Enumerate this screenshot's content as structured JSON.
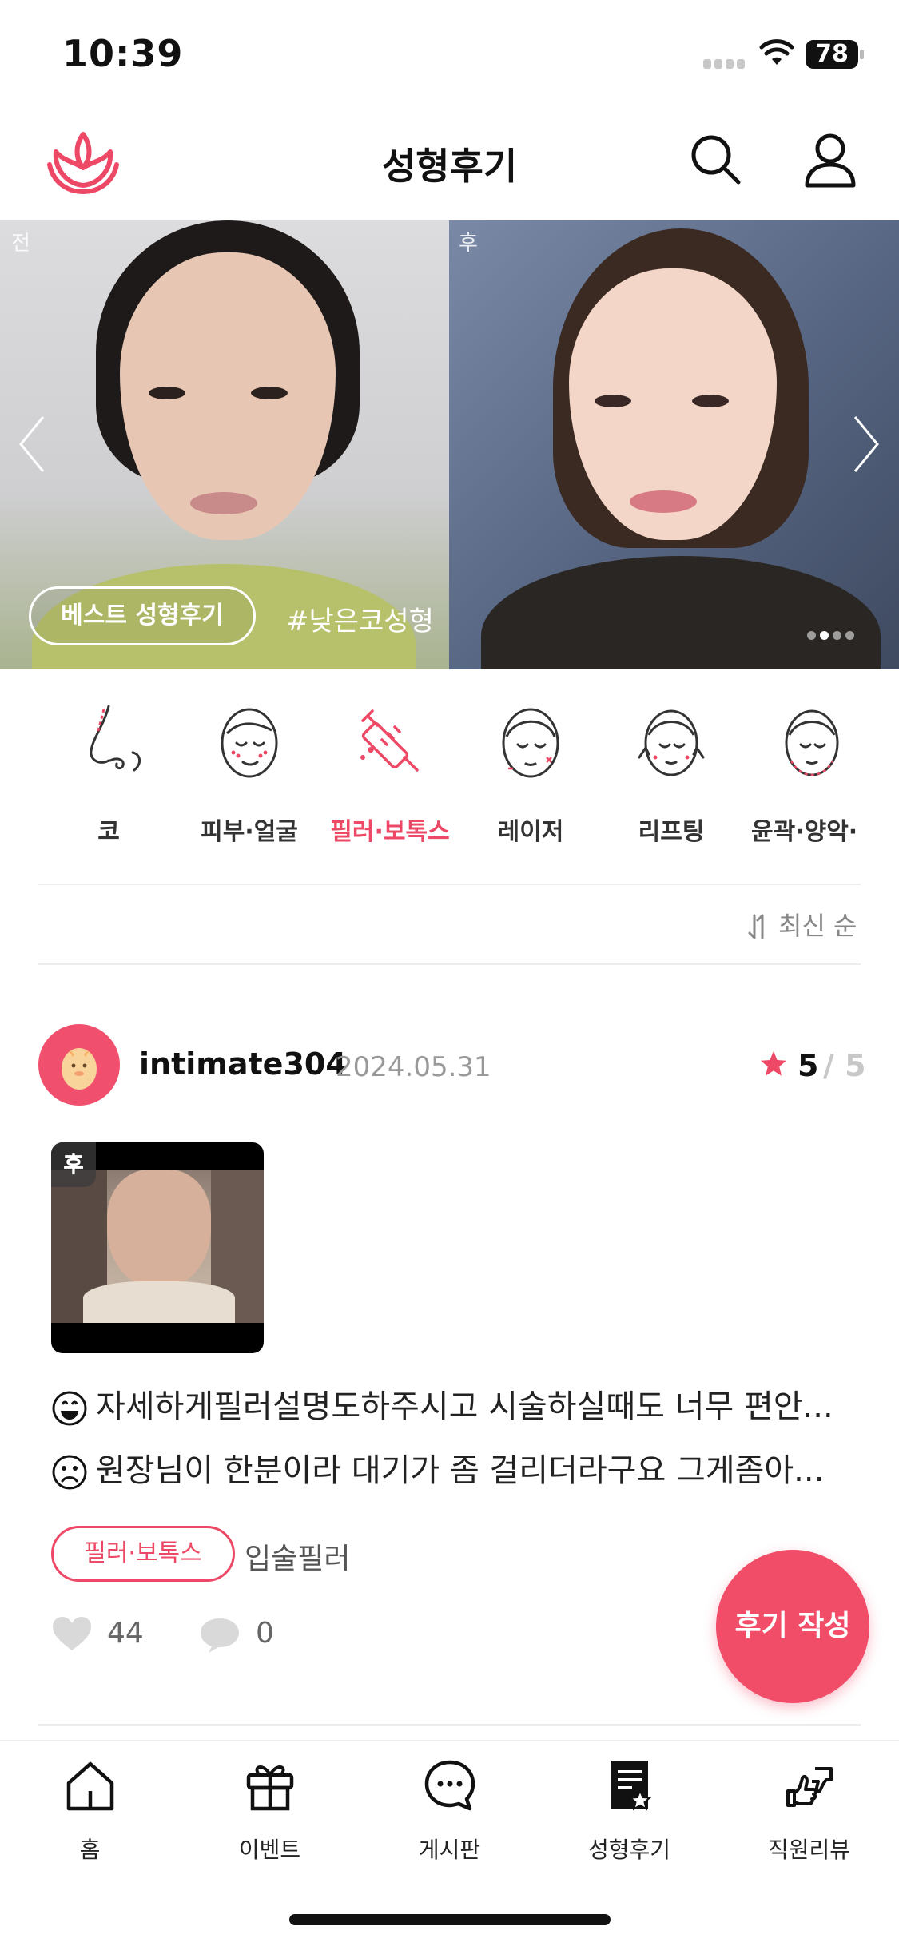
{
  "status_bar": {
    "time": "10:39",
    "battery": "78"
  },
  "header": {
    "title": "성형후기",
    "logo_icon": "lotus-logo-icon",
    "search_icon": "search-icon",
    "user_icon": "user-icon"
  },
  "banner": {
    "before_label": "전",
    "after_label": "후",
    "best_button": "베스트 성형후기",
    "hashtag": "#낮은코성형",
    "page_count": 4,
    "active_page": 2
  },
  "categories": [
    {
      "label": "코",
      "icon": "nose-icon"
    },
    {
      "label": "피부·얼굴",
      "icon": "face-skin-icon"
    },
    {
      "label": "필러·보톡스",
      "icon": "syringe-icon",
      "active": true
    },
    {
      "label": "레이저",
      "icon": "laser-face-icon"
    },
    {
      "label": "리프팅",
      "icon": "lifting-face-icon"
    },
    {
      "label": "윤곽·양악·",
      "icon": "contour-face-icon"
    }
  ],
  "sort": {
    "label": "최신 순"
  },
  "review": {
    "username": "intimate304",
    "date": "2024.05.31",
    "rating": "5",
    "rating_max": "/ 5",
    "photo_badge": "후",
    "good": "자세하게필러설명도하주시고 시술하실때도 너무 편안...",
    "bad": "원장님이 한분이라 대기가 좀 걸리더라구요 그게좀아...",
    "tag": "필러·보톡스",
    "procedure": "입술필러",
    "likes": "44",
    "comments": "0"
  },
  "fab": {
    "label": "후기 작성"
  },
  "tabbar": [
    {
      "label": "홈",
      "icon": "home-icon"
    },
    {
      "label": "이벤트",
      "icon": "gift-icon"
    },
    {
      "label": "게시판",
      "icon": "chat-bubble-icon"
    },
    {
      "label": "성형후기",
      "icon": "review-document-icon",
      "active": true
    },
    {
      "label": "직원리뷰",
      "icon": "thumbs-icon"
    }
  ],
  "colors": {
    "accent": "#ee4867",
    "fab": "#f14d69",
    "text": "#222222",
    "muted": "#999999"
  }
}
